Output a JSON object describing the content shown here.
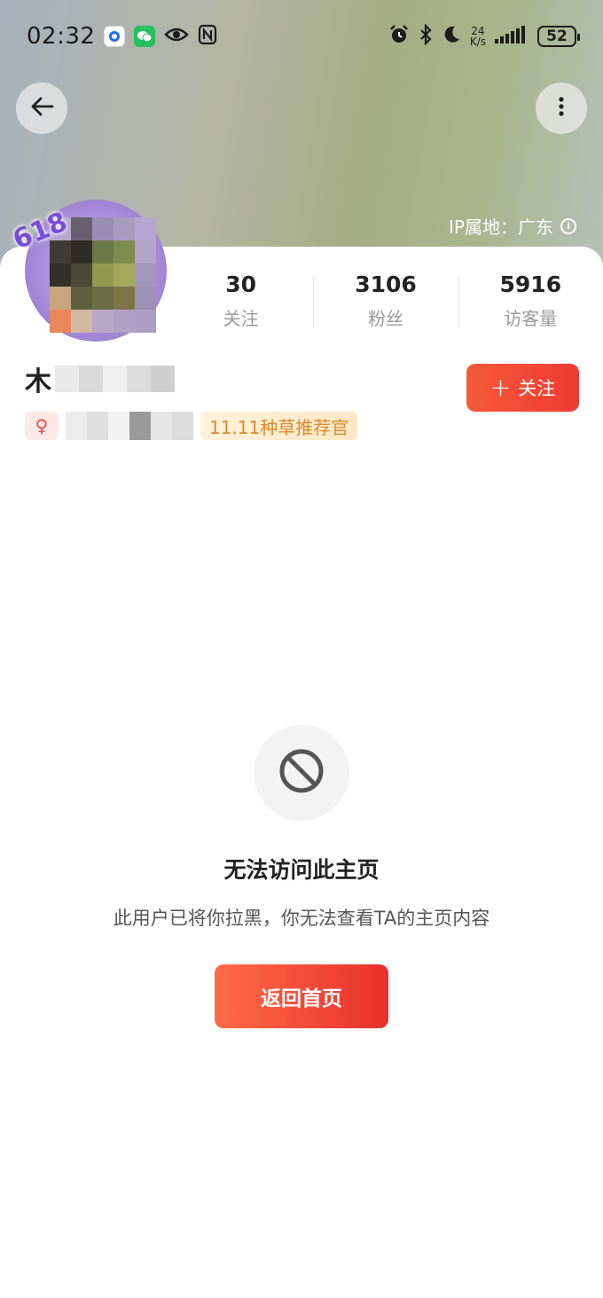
{
  "status_bar": {
    "time": "02:32",
    "net_speed_value": "24",
    "net_speed_unit": "K/s",
    "battery": "52",
    "icons": [
      "app-blue-icon",
      "wechat-icon",
      "eye-icon",
      "nfc-icon",
      "alarm-icon",
      "bluetooth-icon",
      "moon-icon",
      "signal-icon",
      "battery-icon"
    ]
  },
  "header": {
    "back_icon": "arrow-left-icon",
    "more_icon": "more-vertical-icon",
    "ip_location": "IP属地：广东",
    "info_icon": "info-icon"
  },
  "profile": {
    "avatar_badge": "618",
    "username_visible": "木",
    "stats": [
      {
        "value": "30",
        "label": "关注"
      },
      {
        "value": "3106",
        "label": "粉丝"
      },
      {
        "value": "5916",
        "label": "访客量"
      }
    ],
    "follow_button": "关注",
    "gender_symbol": "♀",
    "honor_tag": "11.11种草推荐官"
  },
  "blocked": {
    "title": "无法访问此主页",
    "description": "此用户已将你拉黑，你无法查看TA的主页内容",
    "button": "返回首页"
  },
  "colors": {
    "accent_red": "#f03a32",
    "honor_text": "#d98a2b",
    "gender_pink": "#e84b4b"
  }
}
